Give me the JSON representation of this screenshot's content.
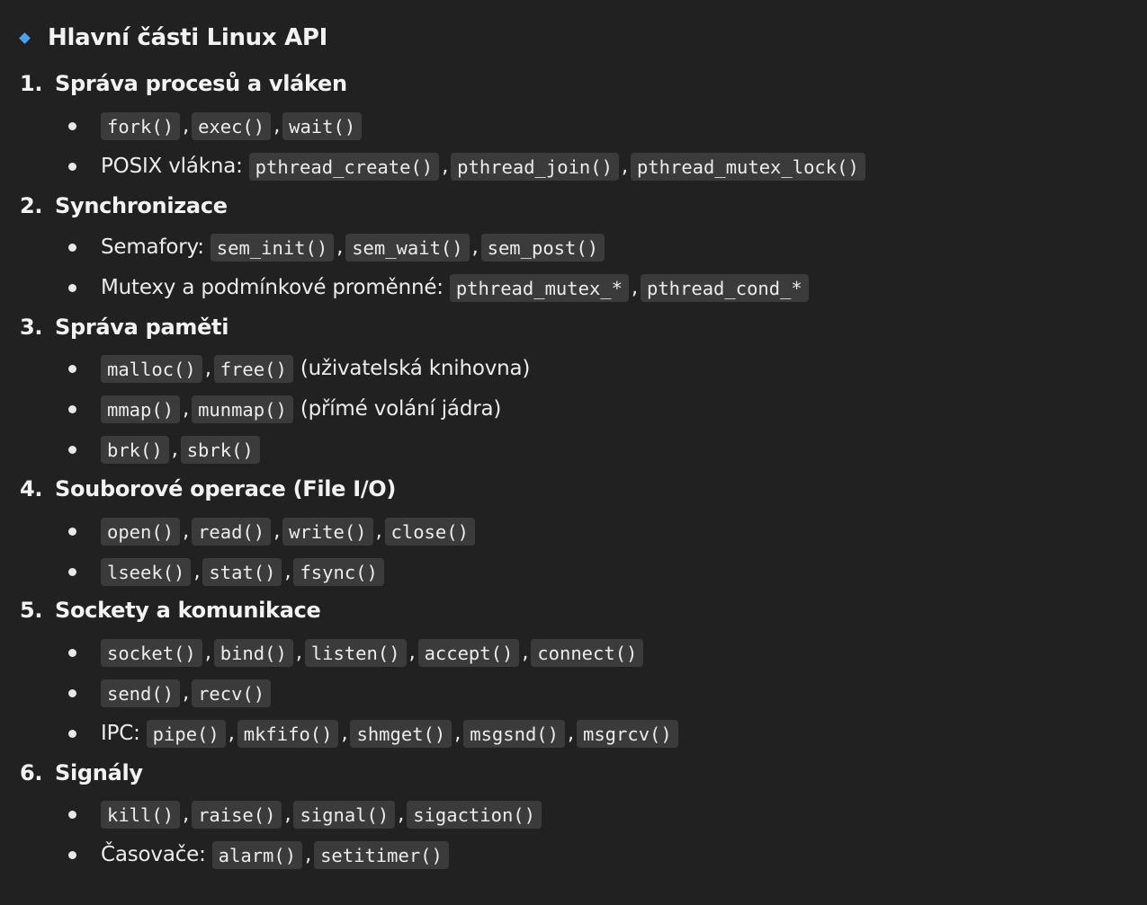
{
  "heading": "Hlavní části Linux API",
  "sections": [
    {
      "num": "1.",
      "title": "Správa procesů a vláken",
      "items": [
        {
          "prefix": "",
          "codes": [
            "fork()",
            "exec()",
            "wait()"
          ],
          "suffix": ""
        },
        {
          "prefix": "POSIX vlákna:",
          "codes": [
            "pthread_create()",
            "pthread_join()",
            "pthread_mutex_lock()"
          ],
          "suffix": ""
        }
      ]
    },
    {
      "num": "2.",
      "title": "Synchronizace",
      "items": [
        {
          "prefix": "Semafory:",
          "codes": [
            "sem_init()",
            "sem_wait()",
            "sem_post()"
          ],
          "suffix": ""
        },
        {
          "prefix": "Mutexy a podmínkové proměnné:",
          "codes": [
            "pthread_mutex_*",
            "pthread_cond_*"
          ],
          "suffix": ""
        }
      ]
    },
    {
      "num": "3.",
      "title": "Správa paměti",
      "items": [
        {
          "prefix": "",
          "codes": [
            "malloc()",
            "free()"
          ],
          "suffix": "(uživatelská knihovna)"
        },
        {
          "prefix": "",
          "codes": [
            "mmap()",
            "munmap()"
          ],
          "suffix": "(přímé volání jádra)"
        },
        {
          "prefix": "",
          "codes": [
            "brk()",
            "sbrk()"
          ],
          "suffix": ""
        }
      ]
    },
    {
      "num": "4.",
      "title": "Souborové operace (File I/O)",
      "items": [
        {
          "prefix": "",
          "codes": [
            "open()",
            "read()",
            "write()",
            "close()"
          ],
          "suffix": ""
        },
        {
          "prefix": "",
          "codes": [
            "lseek()",
            "stat()",
            "fsync()"
          ],
          "suffix": ""
        }
      ]
    },
    {
      "num": "5.",
      "title": "Sockety a komunikace",
      "items": [
        {
          "prefix": "",
          "codes": [
            "socket()",
            "bind()",
            "listen()",
            "accept()",
            "connect()"
          ],
          "suffix": ""
        },
        {
          "prefix": "",
          "codes": [
            "send()",
            "recv()"
          ],
          "suffix": ""
        },
        {
          "prefix": "IPC:",
          "codes": [
            "pipe()",
            "mkfifo()",
            "shmget()",
            "msgsnd()",
            "msgrcv()"
          ],
          "suffix": ""
        }
      ]
    },
    {
      "num": "6.",
      "title": "Signály",
      "items": [
        {
          "prefix": "",
          "codes": [
            "kill()",
            "raise()",
            "signal()",
            "sigaction()"
          ],
          "suffix": ""
        },
        {
          "prefix": "Časovače:",
          "codes": [
            "alarm()",
            "setitimer()"
          ],
          "suffix": ""
        }
      ]
    }
  ]
}
